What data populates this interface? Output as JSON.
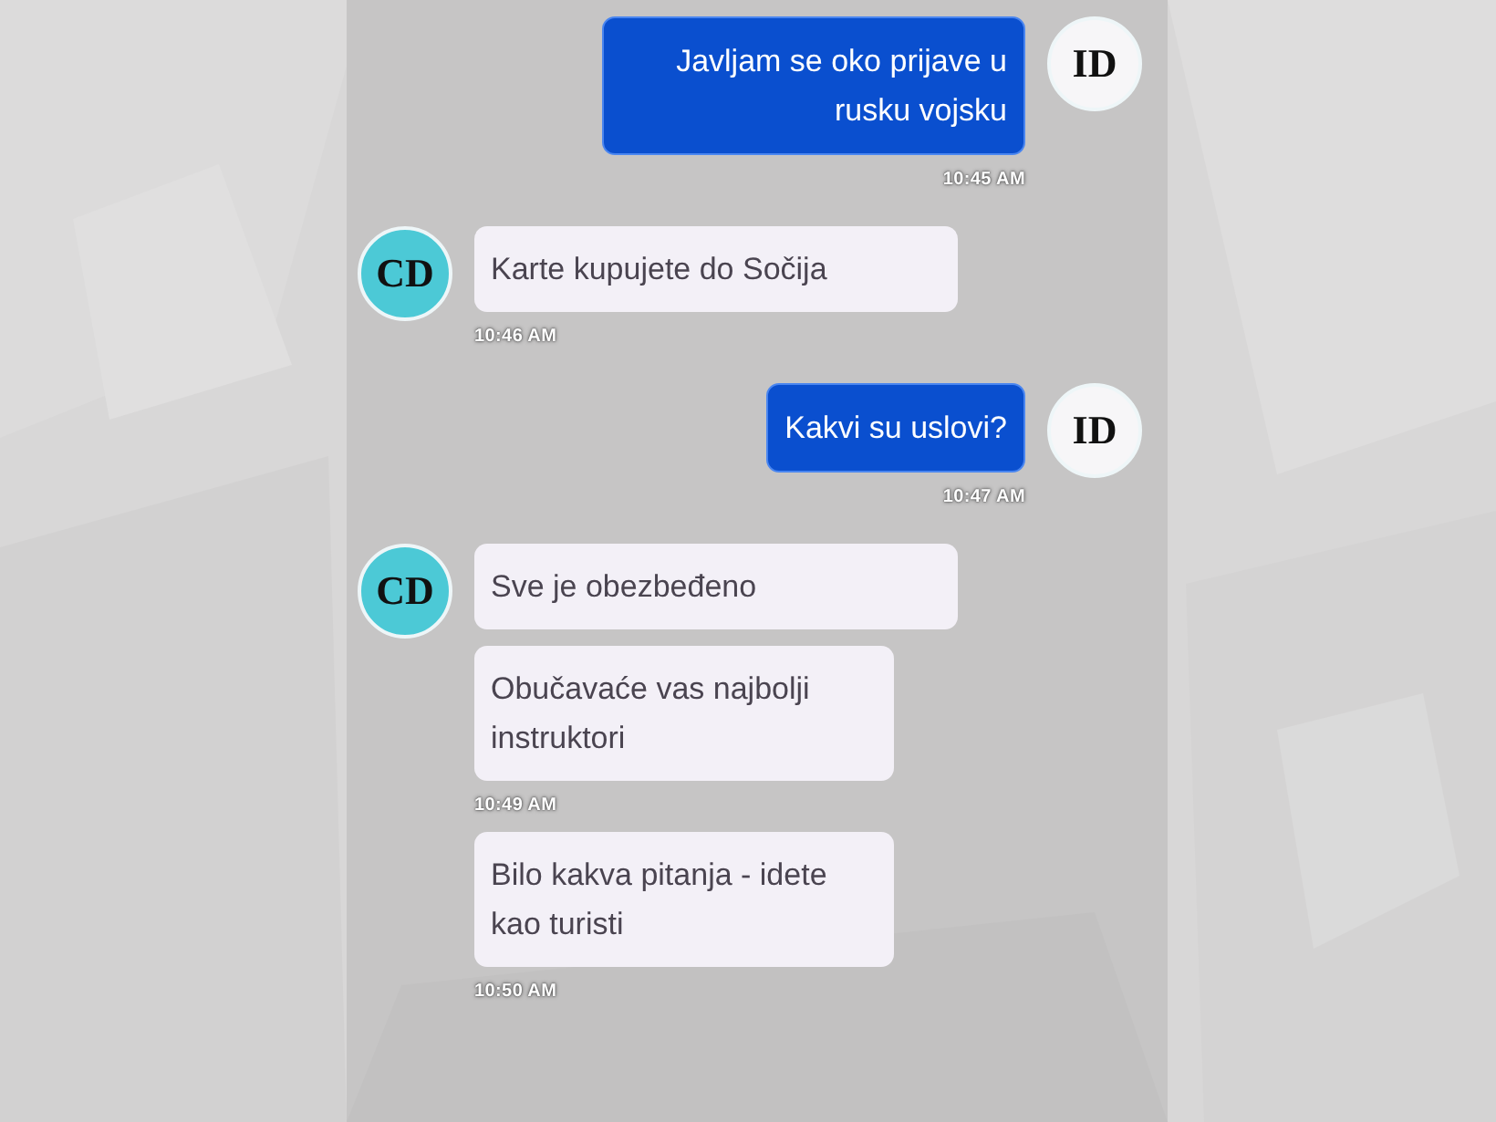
{
  "groups": [
    {
      "kind": "outgoing",
      "avatar": "ID",
      "messages": [
        {
          "text": "Javljam se oko prijave u rusku vojsku",
          "time": "10:45 AM"
        }
      ]
    },
    {
      "kind": "incoming",
      "avatar": "CD",
      "messages": [
        {
          "text": "Karte kupujete do Sočija",
          "time": "10:46 AM"
        }
      ]
    },
    {
      "kind": "outgoing",
      "avatar": "ID",
      "messages": [
        {
          "text": "Kakvi su uslovi?",
          "time": "10:47 AM"
        }
      ]
    },
    {
      "kind": "incoming",
      "avatar": "CD",
      "messages": [
        {
          "text": "Sve je obezbeđeno"
        },
        {
          "text": "Obučavaće vas najbolji instruktori",
          "time": "10:49 AM"
        },
        {
          "text": "Bilo kakva pitanja - idete kao turisti",
          "time": "10:50 AM"
        }
      ]
    }
  ]
}
